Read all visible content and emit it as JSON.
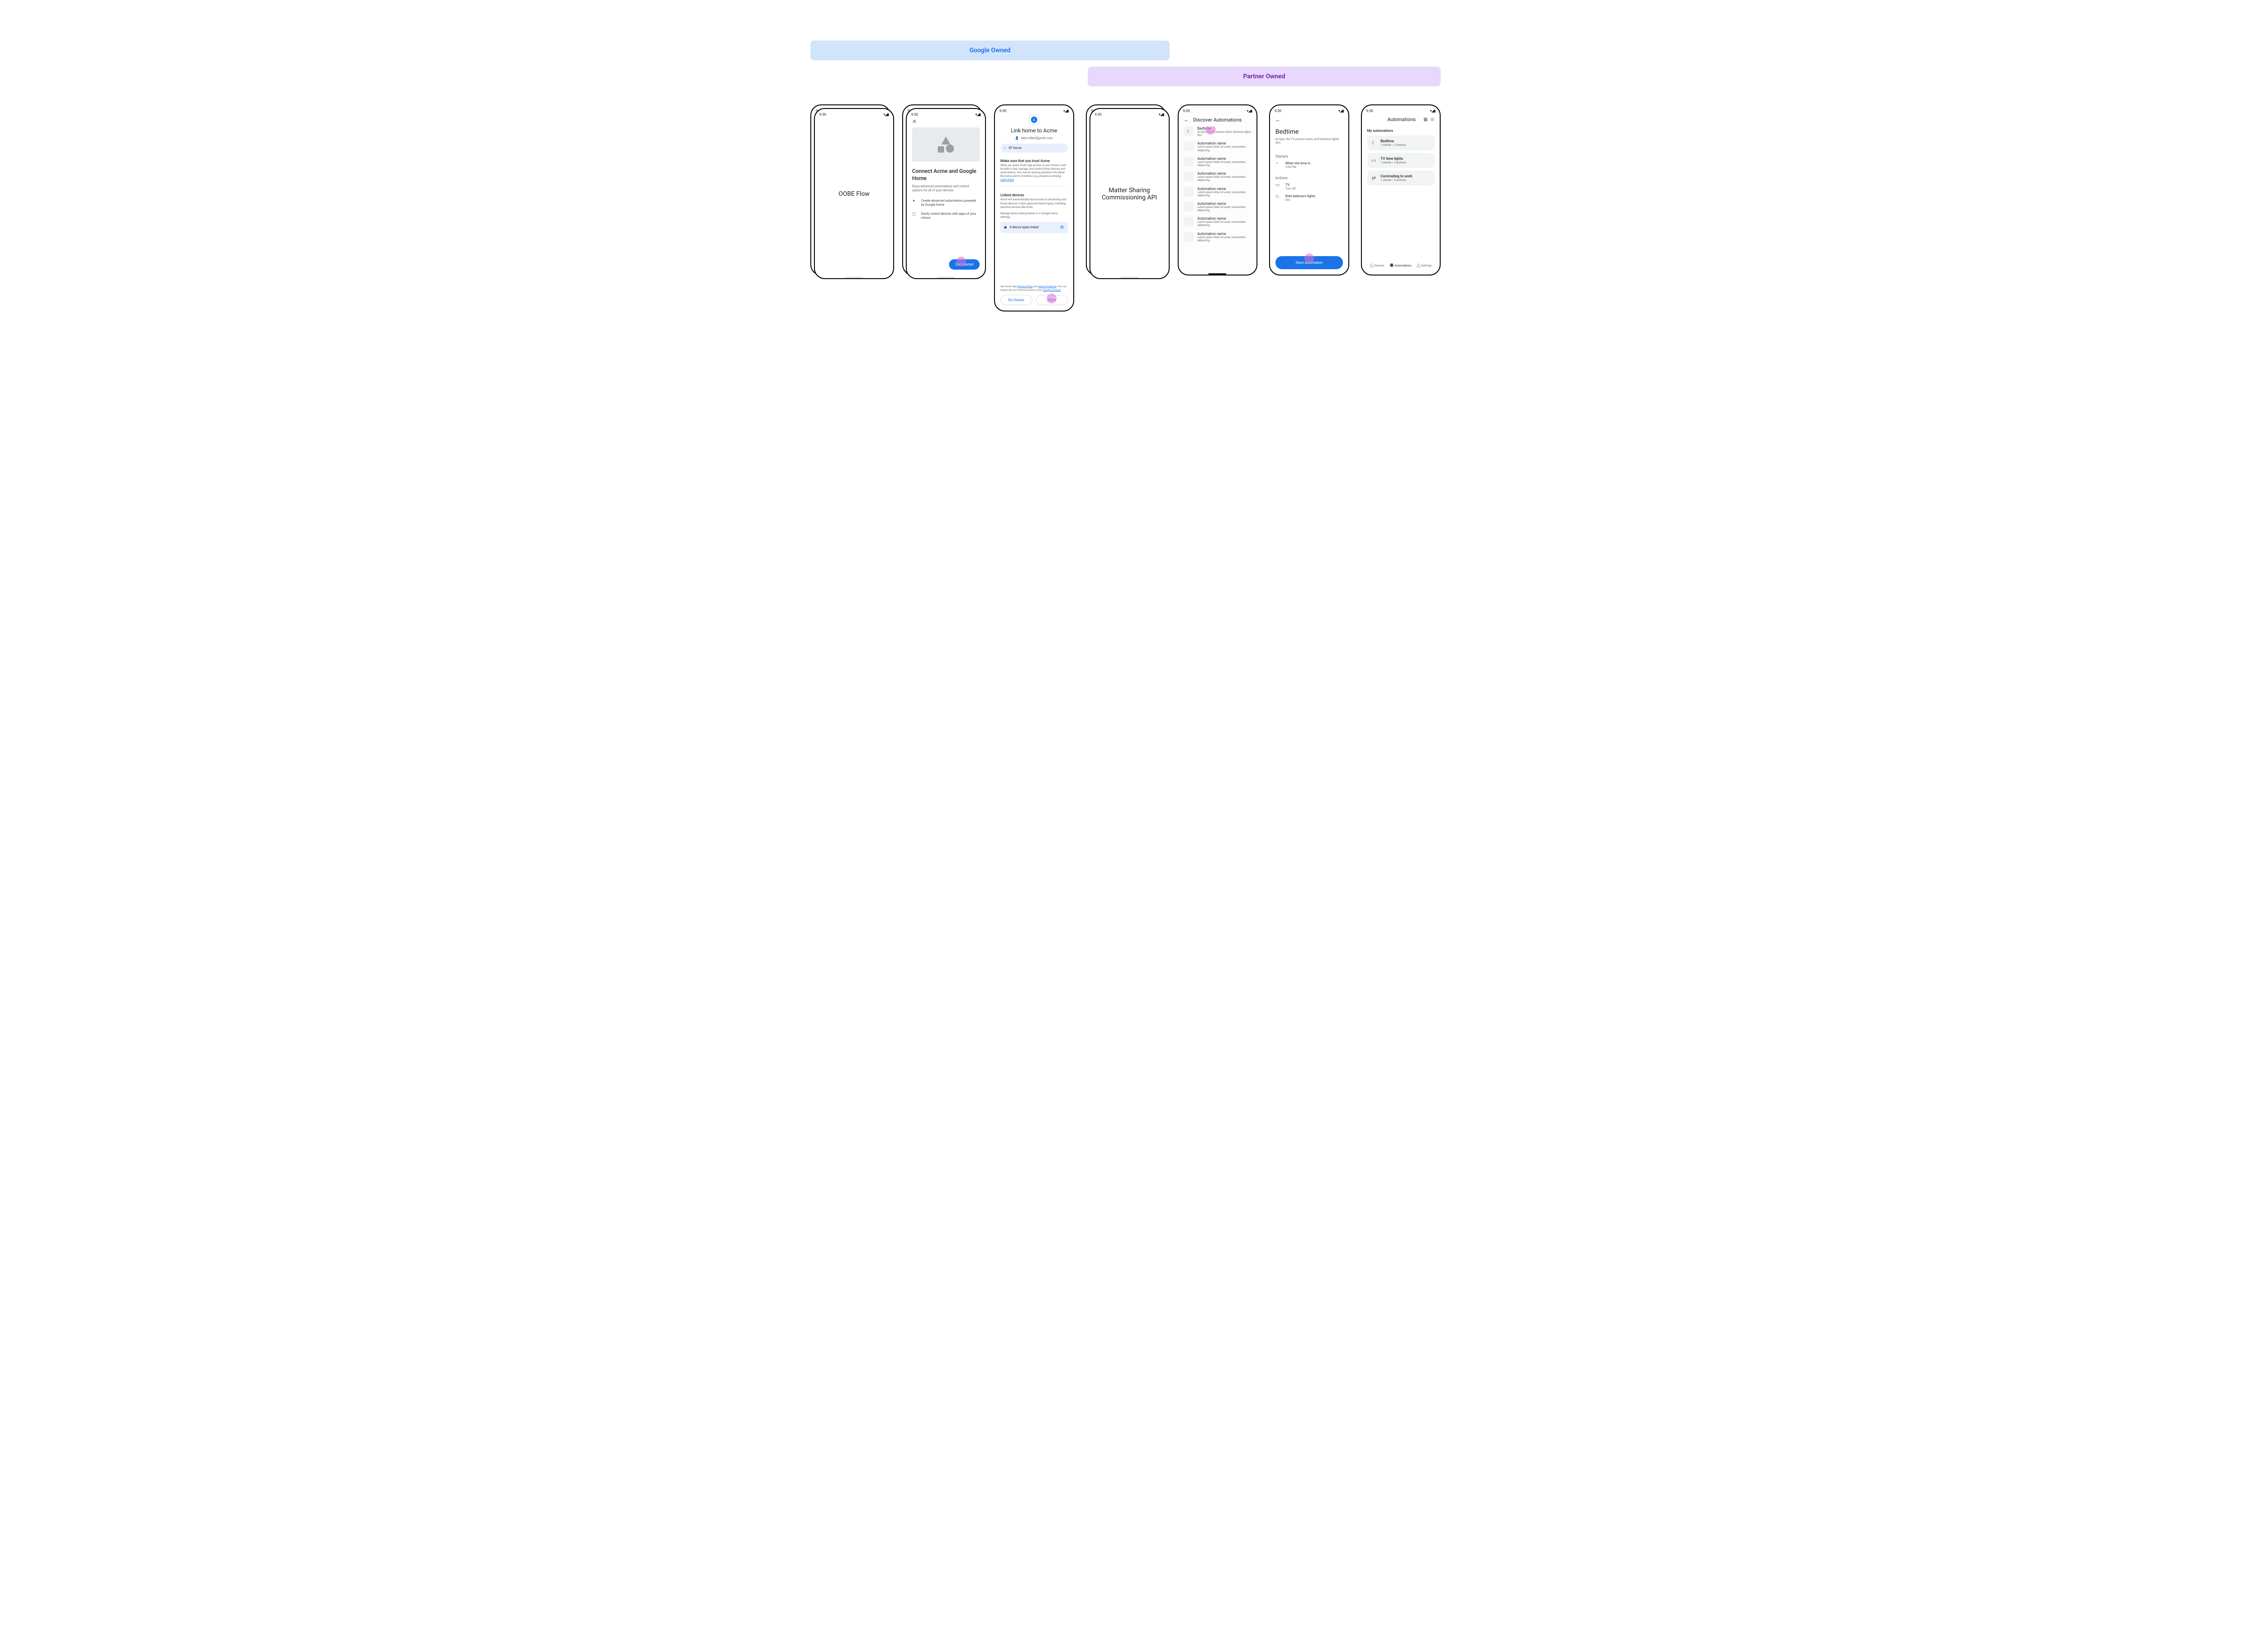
{
  "banners": {
    "google": "Google Owned",
    "partner": "Partner Owned"
  },
  "status": {
    "time": "9:30",
    "icons": "▾◢▮"
  },
  "phone1": {
    "label": "OOBE Flow"
  },
  "phone2": {
    "close": "✕",
    "title": "Connect Acme and Google Home",
    "subtitle": "Enjoy advanced automations and control options for all of your devices",
    "bullets": [
      {
        "icon": "✦",
        "text": "Create advanced automations powered by Google Home"
      },
      {
        "icon": "▢",
        "text": "Easily control devices with apps of your choice"
      }
    ],
    "cta": "Get started"
  },
  "phone3": {
    "app_glyph": "A",
    "title": "Link home to Acme",
    "email": "alex.miller@gmail.com",
    "home_chip": "SF Home",
    "trust_title": "Make sure that you trust Acme",
    "trust_body": "When you grant Smart App access to your Home, it will be able to  see, manage, and control those devices and automations. You may be sharing sensitive info about the home and its members (e.g. presence sensing). ",
    "learn_more": "Learn more",
    "linked_title": "Linked devices",
    "linked_body": "Acme will automatically have access to all existing and future devices in their approved device types, including sensitive devices like locks.",
    "manage_text": "Manage device linking below or in Google Home settings.",
    "device_chip": "4 device types linked",
    "footer_pre": "See Smart App ",
    "privacy": "Privacy Policy",
    "and": " and ",
    "tos": "Terms of Service",
    "footer_post1": ". You can always see and remove access in your ",
    "google_account": "Google Account",
    "footer_post2": ".",
    "no_thanks": "No thanks",
    "allow": "Allow"
  },
  "phone4": {
    "label": "Matter Sharing Commissioning API"
  },
  "phone5": {
    "title": "Discover Automations",
    "items": [
      {
        "icon": "☾",
        "title": "Bedtime",
        "sub": "At 9pm, the TV powers down, bedroom lights dim."
      },
      {
        "icon": "",
        "title": "Automation name",
        "sub": "Lorem ipsum dolor sit amet, consectetur adipiscing."
      },
      {
        "icon": "",
        "title": "Automation name",
        "sub": "Lorem ipsum dolor sit amet, consectetur adipiscing."
      },
      {
        "icon": "",
        "title": "Automation name",
        "sub": "Lorem ipsum dolor sit amet, consectetur adipiscing."
      },
      {
        "icon": "",
        "title": "Automation name",
        "sub": "Lorem ipsum dolor sit amet, consectetur adipiscing."
      },
      {
        "icon": "",
        "title": "Automation name",
        "sub": "Lorem ipsum dolor sit amet, consectetur adipiscing."
      },
      {
        "icon": "",
        "title": "Automation name",
        "sub": "Lorem ipsum dolor sit amet, consectetur adipiscing."
      },
      {
        "icon": "",
        "title": "Automation name",
        "sub": "Lorem ipsum dolor sit amet, consectetur adipiscing."
      }
    ]
  },
  "phone6": {
    "title": "Bedtime",
    "subtitle": "At 9pm, the TV powers down, and bedroom lights dim.",
    "starters_label": "Starters",
    "starter": {
      "icon": "◔",
      "l1": "When the time is",
      "l2": "9:00 PM"
    },
    "actions_label": "Actions",
    "actions": [
      {
        "icon": "▭",
        "l1": "TV",
        "l2": "Turn off"
      },
      {
        "icon": "◇",
        "l1": "Kids bedroom lights",
        "l2": "Dim"
      }
    ],
    "save": "Save automation"
  },
  "phone7": {
    "title": "Automations",
    "group_label": "My automations",
    "cards": [
      {
        "icon": "☾",
        "title": "Bedtime",
        "sub": "1 starter • 2 actions"
      },
      {
        "icon": "▭",
        "title": "TV time lights",
        "sub": "1 starter • 2 actions"
      },
      {
        "icon": "⇄",
        "title": "Commuting to work",
        "sub": "1 starter • 3 actions"
      }
    ],
    "nav": [
      {
        "icon": "△",
        "label": "Devices"
      },
      {
        "icon": "◉",
        "label": "Automations"
      },
      {
        "icon": "△",
        "label": "Settings"
      }
    ]
  }
}
